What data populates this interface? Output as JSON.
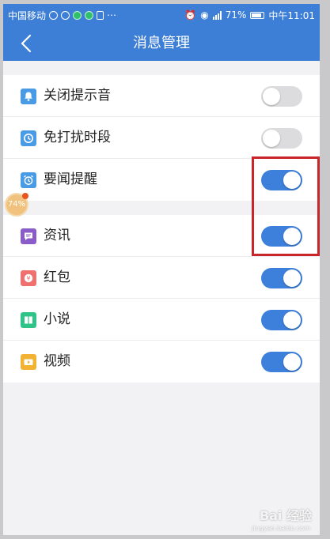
{
  "status_bar": {
    "carrier": "中国移动",
    "battery_percent": "71%",
    "time": "中午11:01",
    "icons": [
      "alarm-icon",
      "eye-icon",
      "wifi-icon",
      "signal-icon",
      "battery-icon"
    ]
  },
  "nav": {
    "back_icon": "chevron-left-icon",
    "title": "消息管理"
  },
  "settings": {
    "group1": [
      {
        "label": "关闭提示音",
        "icon": "bell-icon",
        "icon_color": "#4a9be6",
        "on": false
      },
      {
        "label": "免打扰时段",
        "icon": "clock-icon",
        "icon_color": "#4a9be6",
        "on": false
      },
      {
        "label": "要闻提醒",
        "icon": "alarm-clock-icon",
        "icon_color": "#4a9be6",
        "on": true
      }
    ],
    "group2": [
      {
        "label": "资讯",
        "icon": "message-icon",
        "icon_color": "#8a5cc7",
        "on": true
      },
      {
        "label": "红包",
        "icon": "red-packet-icon",
        "icon_color": "#f07070",
        "on": true
      },
      {
        "label": "小说",
        "icon": "book-icon",
        "icon_color": "#2ec487",
        "on": true
      },
      {
        "label": "视频",
        "icon": "video-icon",
        "icon_color": "#f2b233",
        "on": true
      }
    ]
  },
  "floating_ball": {
    "text": "74%"
  },
  "watermark": {
    "text": "Bai 经验",
    "sub": "jingyan.baidu.com"
  },
  "colors": {
    "header": "#3d7fd6",
    "toggle_on": "#3d80dc",
    "toggle_off": "#dcdcde",
    "highlight": "#c8262a"
  }
}
